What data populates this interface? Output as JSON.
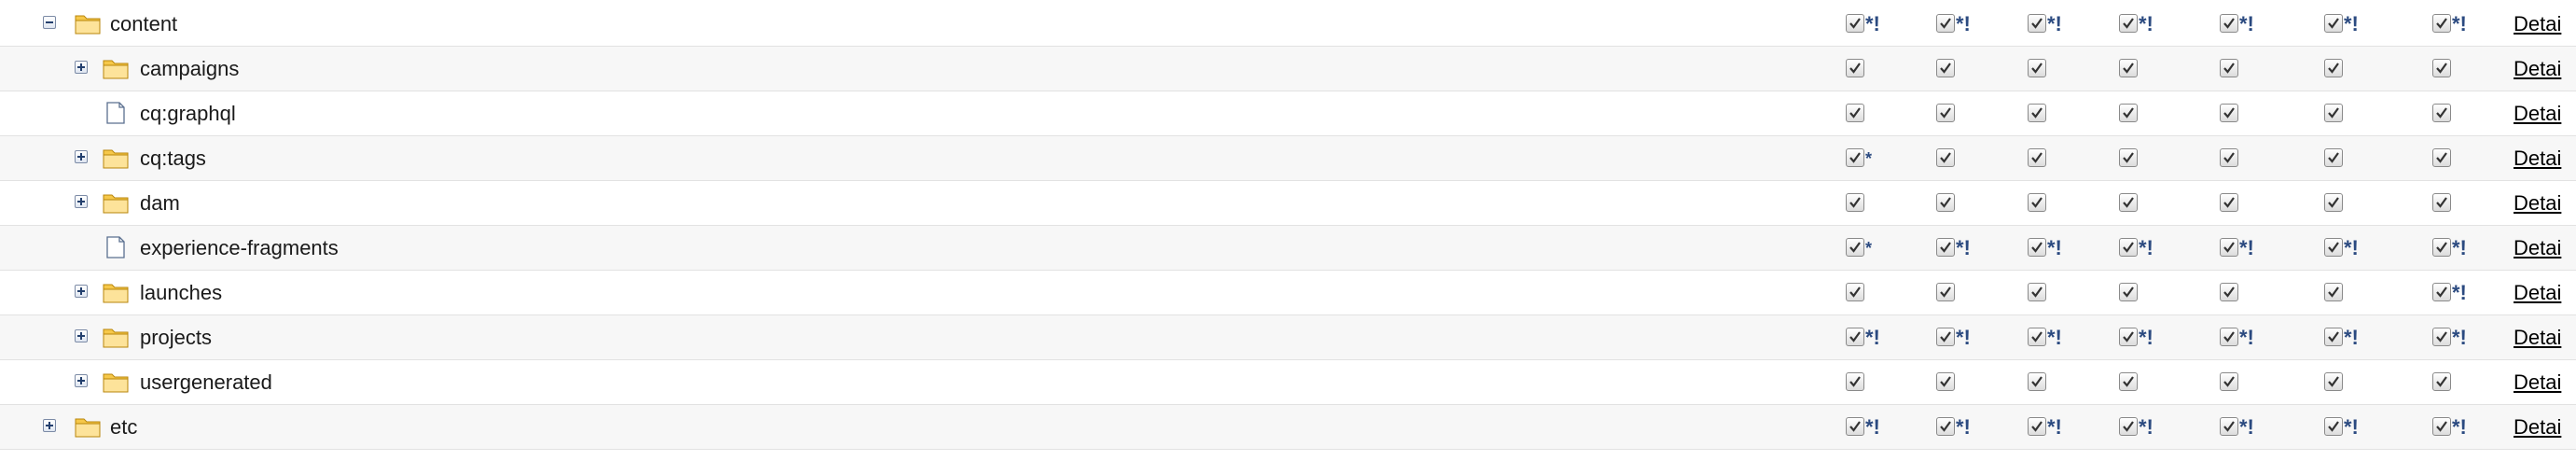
{
  "colors": {
    "row_alt": "#f7f7f7",
    "link": "#000000",
    "marker": "#2b4a80",
    "folder": "#f6c84a"
  },
  "details_label": "Detai",
  "rows": [
    {
      "name": "content",
      "level": 0,
      "icon": "folder-icon",
      "toggle": "minus",
      "marks": [
        "*!",
        "*!",
        "*!",
        "*!",
        "*!",
        "*!",
        "*!"
      ]
    },
    {
      "name": "campaigns",
      "level": 1,
      "icon": "folder-icon",
      "toggle": "plus",
      "marks": [
        "",
        "",
        "",
        "",
        "",
        "",
        ""
      ]
    },
    {
      "name": "cq:graphql",
      "level": 1,
      "icon": "page-icon",
      "toggle": "none",
      "marks": [
        "",
        "",
        "",
        "",
        "",
        "",
        ""
      ]
    },
    {
      "name": "cq:tags",
      "level": 1,
      "icon": "folder-icon",
      "toggle": "plus",
      "marks": [
        "*",
        "",
        "",
        "",
        "",
        "",
        ""
      ]
    },
    {
      "name": "dam",
      "level": 1,
      "icon": "folder-icon",
      "toggle": "plus",
      "marks": [
        "",
        "",
        "",
        "",
        "",
        "",
        ""
      ]
    },
    {
      "name": "experience-fragments",
      "level": 1,
      "icon": "page-icon",
      "toggle": "none",
      "marks": [
        "*",
        "*!",
        "*!",
        "*!",
        "*!",
        "*!",
        "*!"
      ]
    },
    {
      "name": "launches",
      "level": 1,
      "icon": "folder-icon",
      "toggle": "plus",
      "marks": [
        "",
        "",
        "",
        "",
        "",
        "",
        "*!"
      ]
    },
    {
      "name": "projects",
      "level": 1,
      "icon": "folder-icon",
      "toggle": "plus",
      "marks": [
        "*!",
        "*!",
        "*!",
        "*!",
        "*!",
        "*!",
        "*!"
      ]
    },
    {
      "name": "usergenerated",
      "level": 1,
      "icon": "folder-icon",
      "toggle": "plus",
      "marks": [
        "",
        "",
        "",
        "",
        "",
        "",
        ""
      ]
    },
    {
      "name": "etc",
      "level": 0,
      "icon": "folder-icon",
      "toggle": "plus",
      "marks": [
        "*!",
        "*!",
        "*!",
        "*!",
        "*!",
        "*!",
        "*!"
      ]
    }
  ]
}
